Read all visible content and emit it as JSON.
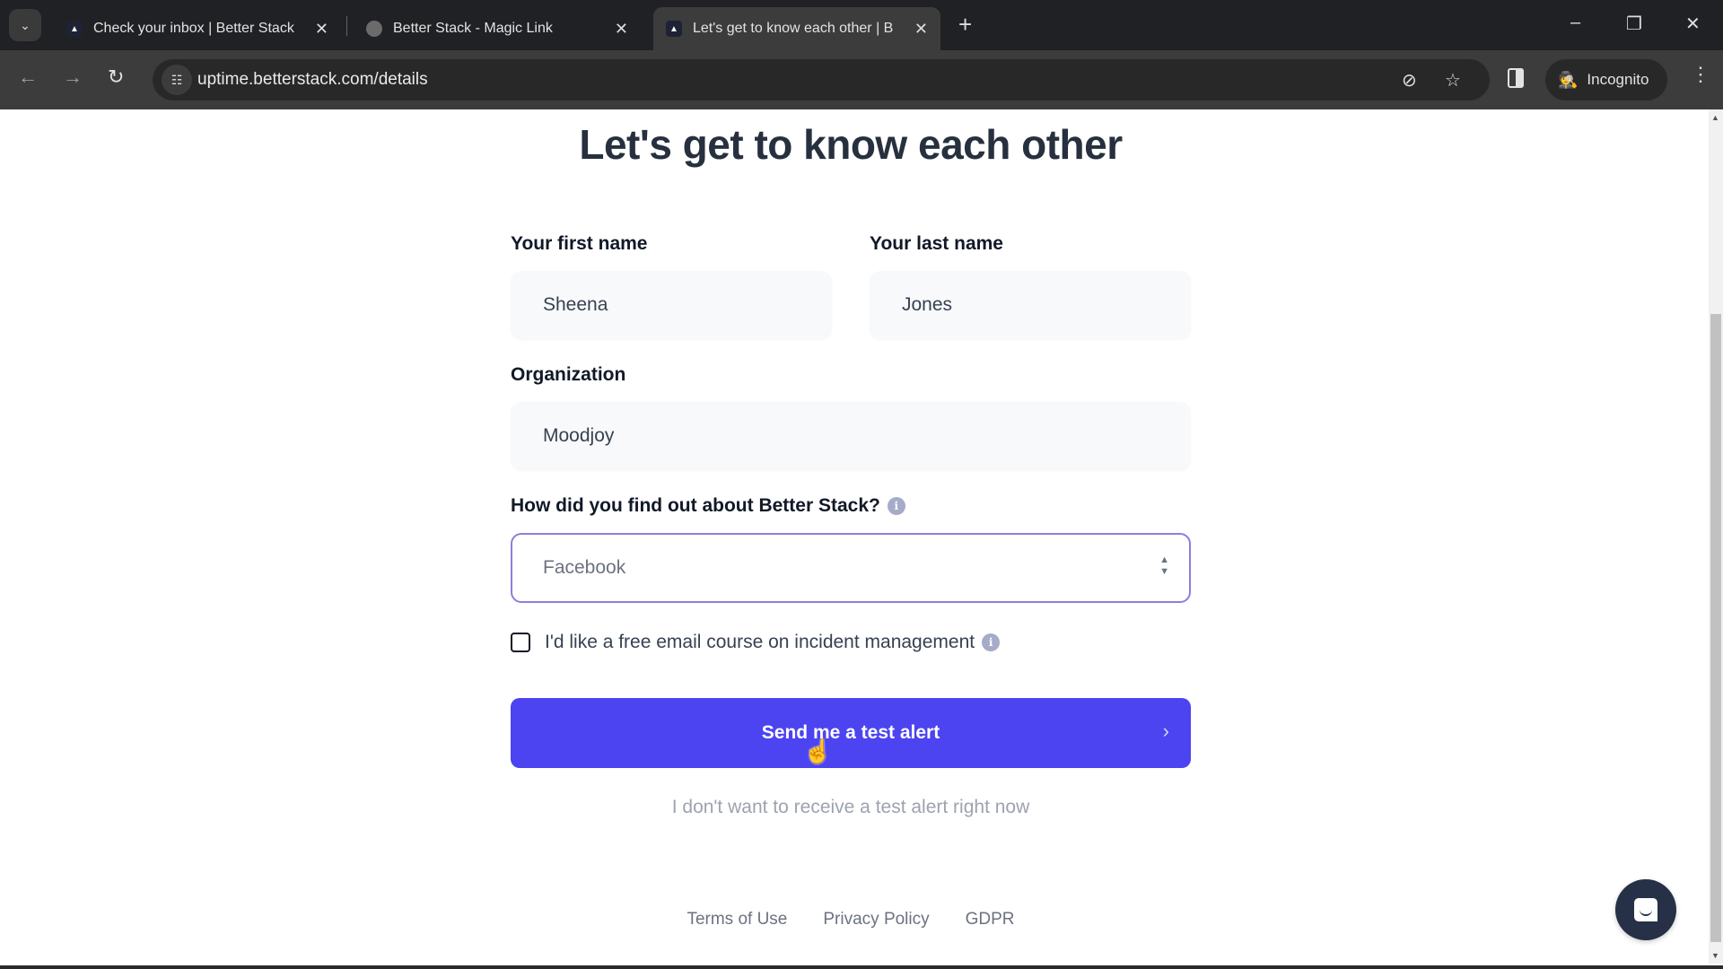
{
  "browser": {
    "tabs": [
      {
        "title": "Check your inbox | Better Stack",
        "favicon": "betterstack-logo-icon",
        "active": false
      },
      {
        "title": "Better Stack - Magic Link",
        "favicon": "globe-icon",
        "active": false
      },
      {
        "title": "Let's get to know each other | B",
        "favicon": "betterstack-logo-icon",
        "active": true
      }
    ],
    "url": "uptime.betterstack.com/details",
    "incognito_label": "Incognito",
    "icons": {
      "tab_search": "⌄",
      "close": "✕",
      "new_tab": "+",
      "back": "←",
      "forward": "→",
      "reload": "↻",
      "site_settings": "☷",
      "eye_off": "⊘",
      "star": "☆",
      "incognito": "🕵",
      "menu": "⋮",
      "minimize": "–",
      "restore": "❐",
      "window_close": "✕"
    }
  },
  "page": {
    "heading": "Let's get to know each other",
    "first_name": {
      "label": "Your first name",
      "value": "Sheena"
    },
    "last_name": {
      "label": "Your last name",
      "value": "Jones"
    },
    "organization": {
      "label": "Organization",
      "value": "Moodjoy"
    },
    "source": {
      "label": "How did you find out about Better Stack?",
      "selected": "Facebook",
      "info_icon": "i"
    },
    "email_course": {
      "label": "I'd like a free email course on incident management",
      "checked": false,
      "info_icon": "i"
    },
    "primary_button": {
      "label": "Send me a test alert",
      "chevron": "›"
    },
    "skip_link": "I don't want to receive a test alert right now",
    "footer": {
      "links": [
        "Terms of Use",
        "Privacy Policy",
        "GDPR"
      ]
    },
    "colors": {
      "accent": "#4c44f0",
      "focus_border": "#8b7fdc",
      "heading": "#27303f",
      "chat_button": "#263046"
    }
  }
}
